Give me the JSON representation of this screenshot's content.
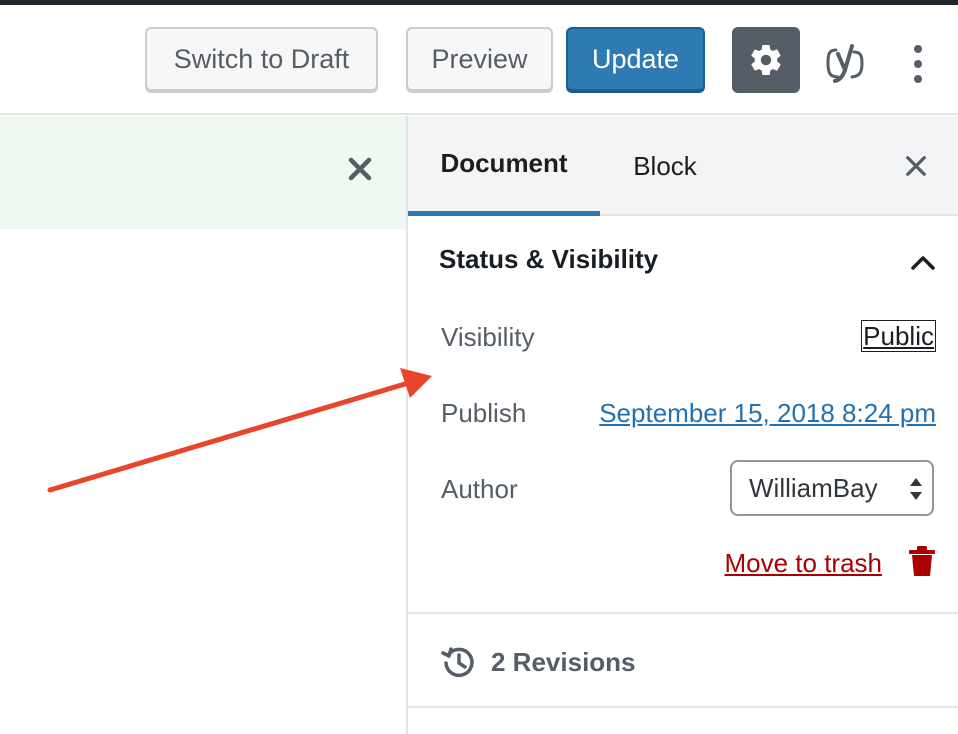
{
  "header": {
    "switch_to_draft_label": "Switch to Draft",
    "preview_label": "Preview",
    "update_label": "Update",
    "settings_icon": "gear-icon",
    "yoast_icon": "yoast-icon",
    "more_icon": "more-vertical-icon"
  },
  "notice": {
    "close_icon": "close-icon"
  },
  "sidebar": {
    "tabs": [
      {
        "label": "Document",
        "active": true
      },
      {
        "label": "Block",
        "active": false
      }
    ],
    "close_icon": "close-icon",
    "panel": {
      "title": "Status & Visibility",
      "expanded": true,
      "visibility_label": "Visibility",
      "visibility_value": "Public",
      "publish_label": "Publish",
      "publish_value": "September 15, 2018 8:24 pm",
      "author_label": "Author",
      "author_value": "WilliamBay",
      "trash_label": "Move to trash"
    },
    "revisions_label": "2 Revisions"
  },
  "colors": {
    "primary": "#2e7bb4",
    "trash": "#aa0000",
    "notice_bg": "#eff9f1",
    "arrow": "#e8452c"
  }
}
